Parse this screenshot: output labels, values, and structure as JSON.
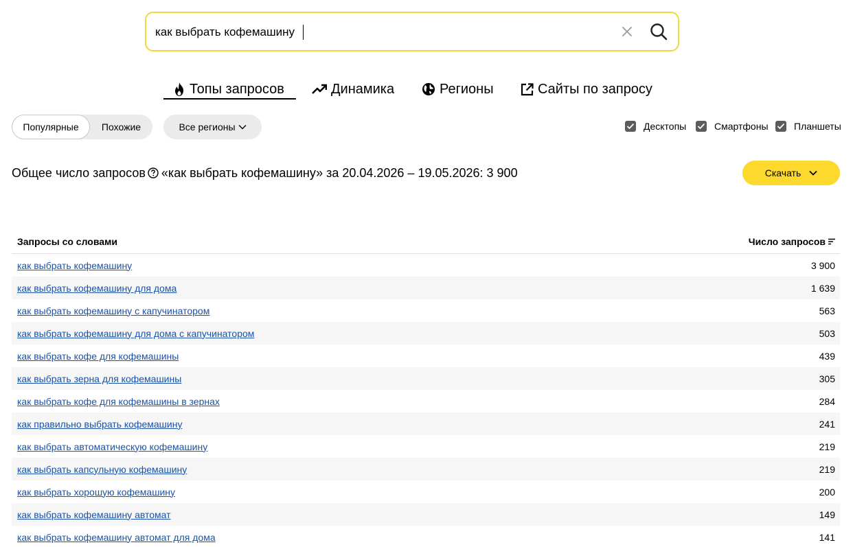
{
  "search": {
    "value": "как выбрать кофемашину",
    "clear_icon": "close-icon",
    "search_icon": "search-icon"
  },
  "tabs": [
    {
      "label": "Топы запросов",
      "icon": "fire-icon",
      "active": true
    },
    {
      "label": "Динамика",
      "icon": "trend-up-icon",
      "active": false
    },
    {
      "label": "Регионы",
      "icon": "globe-icon",
      "active": false
    },
    {
      "label": "Сайты по запросу",
      "icon": "external-link-icon",
      "active": false
    }
  ],
  "filters": {
    "popular": "Популярные",
    "similar": "Похожие",
    "regions": "Все регионы",
    "devices": [
      {
        "label": "Десктопы",
        "checked": true
      },
      {
        "label": "Смартфоны",
        "checked": true
      },
      {
        "label": "Планшеты",
        "checked": true
      }
    ]
  },
  "summary": {
    "prefix": "Общее число запросов",
    "text": "«как выбрать кофемашину» за 20.04.2026 – 19.05.2026: 3 900"
  },
  "download_label": "Скачать",
  "table": {
    "col_query": "Запросы со словами",
    "col_count": "Число запросов",
    "rows": [
      {
        "query": "как выбрать кофемашину",
        "count": "3 900"
      },
      {
        "query": "как выбрать кофемашину для дома",
        "count": "1 639"
      },
      {
        "query": "как выбрать кофемашину с капучинатором",
        "count": "563"
      },
      {
        "query": "как выбрать кофемашину для дома с капучинатором",
        "count": "503"
      },
      {
        "query": "как выбрать кофе для кофемашины",
        "count": "439"
      },
      {
        "query": "как выбрать зерна для кофемашины",
        "count": "305"
      },
      {
        "query": "как выбрать кофе для кофемашины в зернах",
        "count": "284"
      },
      {
        "query": "как правильно выбрать кофемашину",
        "count": "241"
      },
      {
        "query": "как выбрать автоматическую кофемашину",
        "count": "219"
      },
      {
        "query": "как выбрать капсульную кофемашину",
        "count": "219"
      },
      {
        "query": "как выбрать хорошую кофемашину",
        "count": "200"
      },
      {
        "query": "как выбрать кофемашину автомат",
        "count": "149"
      },
      {
        "query": "как выбрать кофемашину автомат для дома",
        "count": "141"
      }
    ]
  },
  "colors": {
    "accent": "#fcd92c",
    "search_border": "#f4d83a",
    "link": "#1a53a7"
  }
}
